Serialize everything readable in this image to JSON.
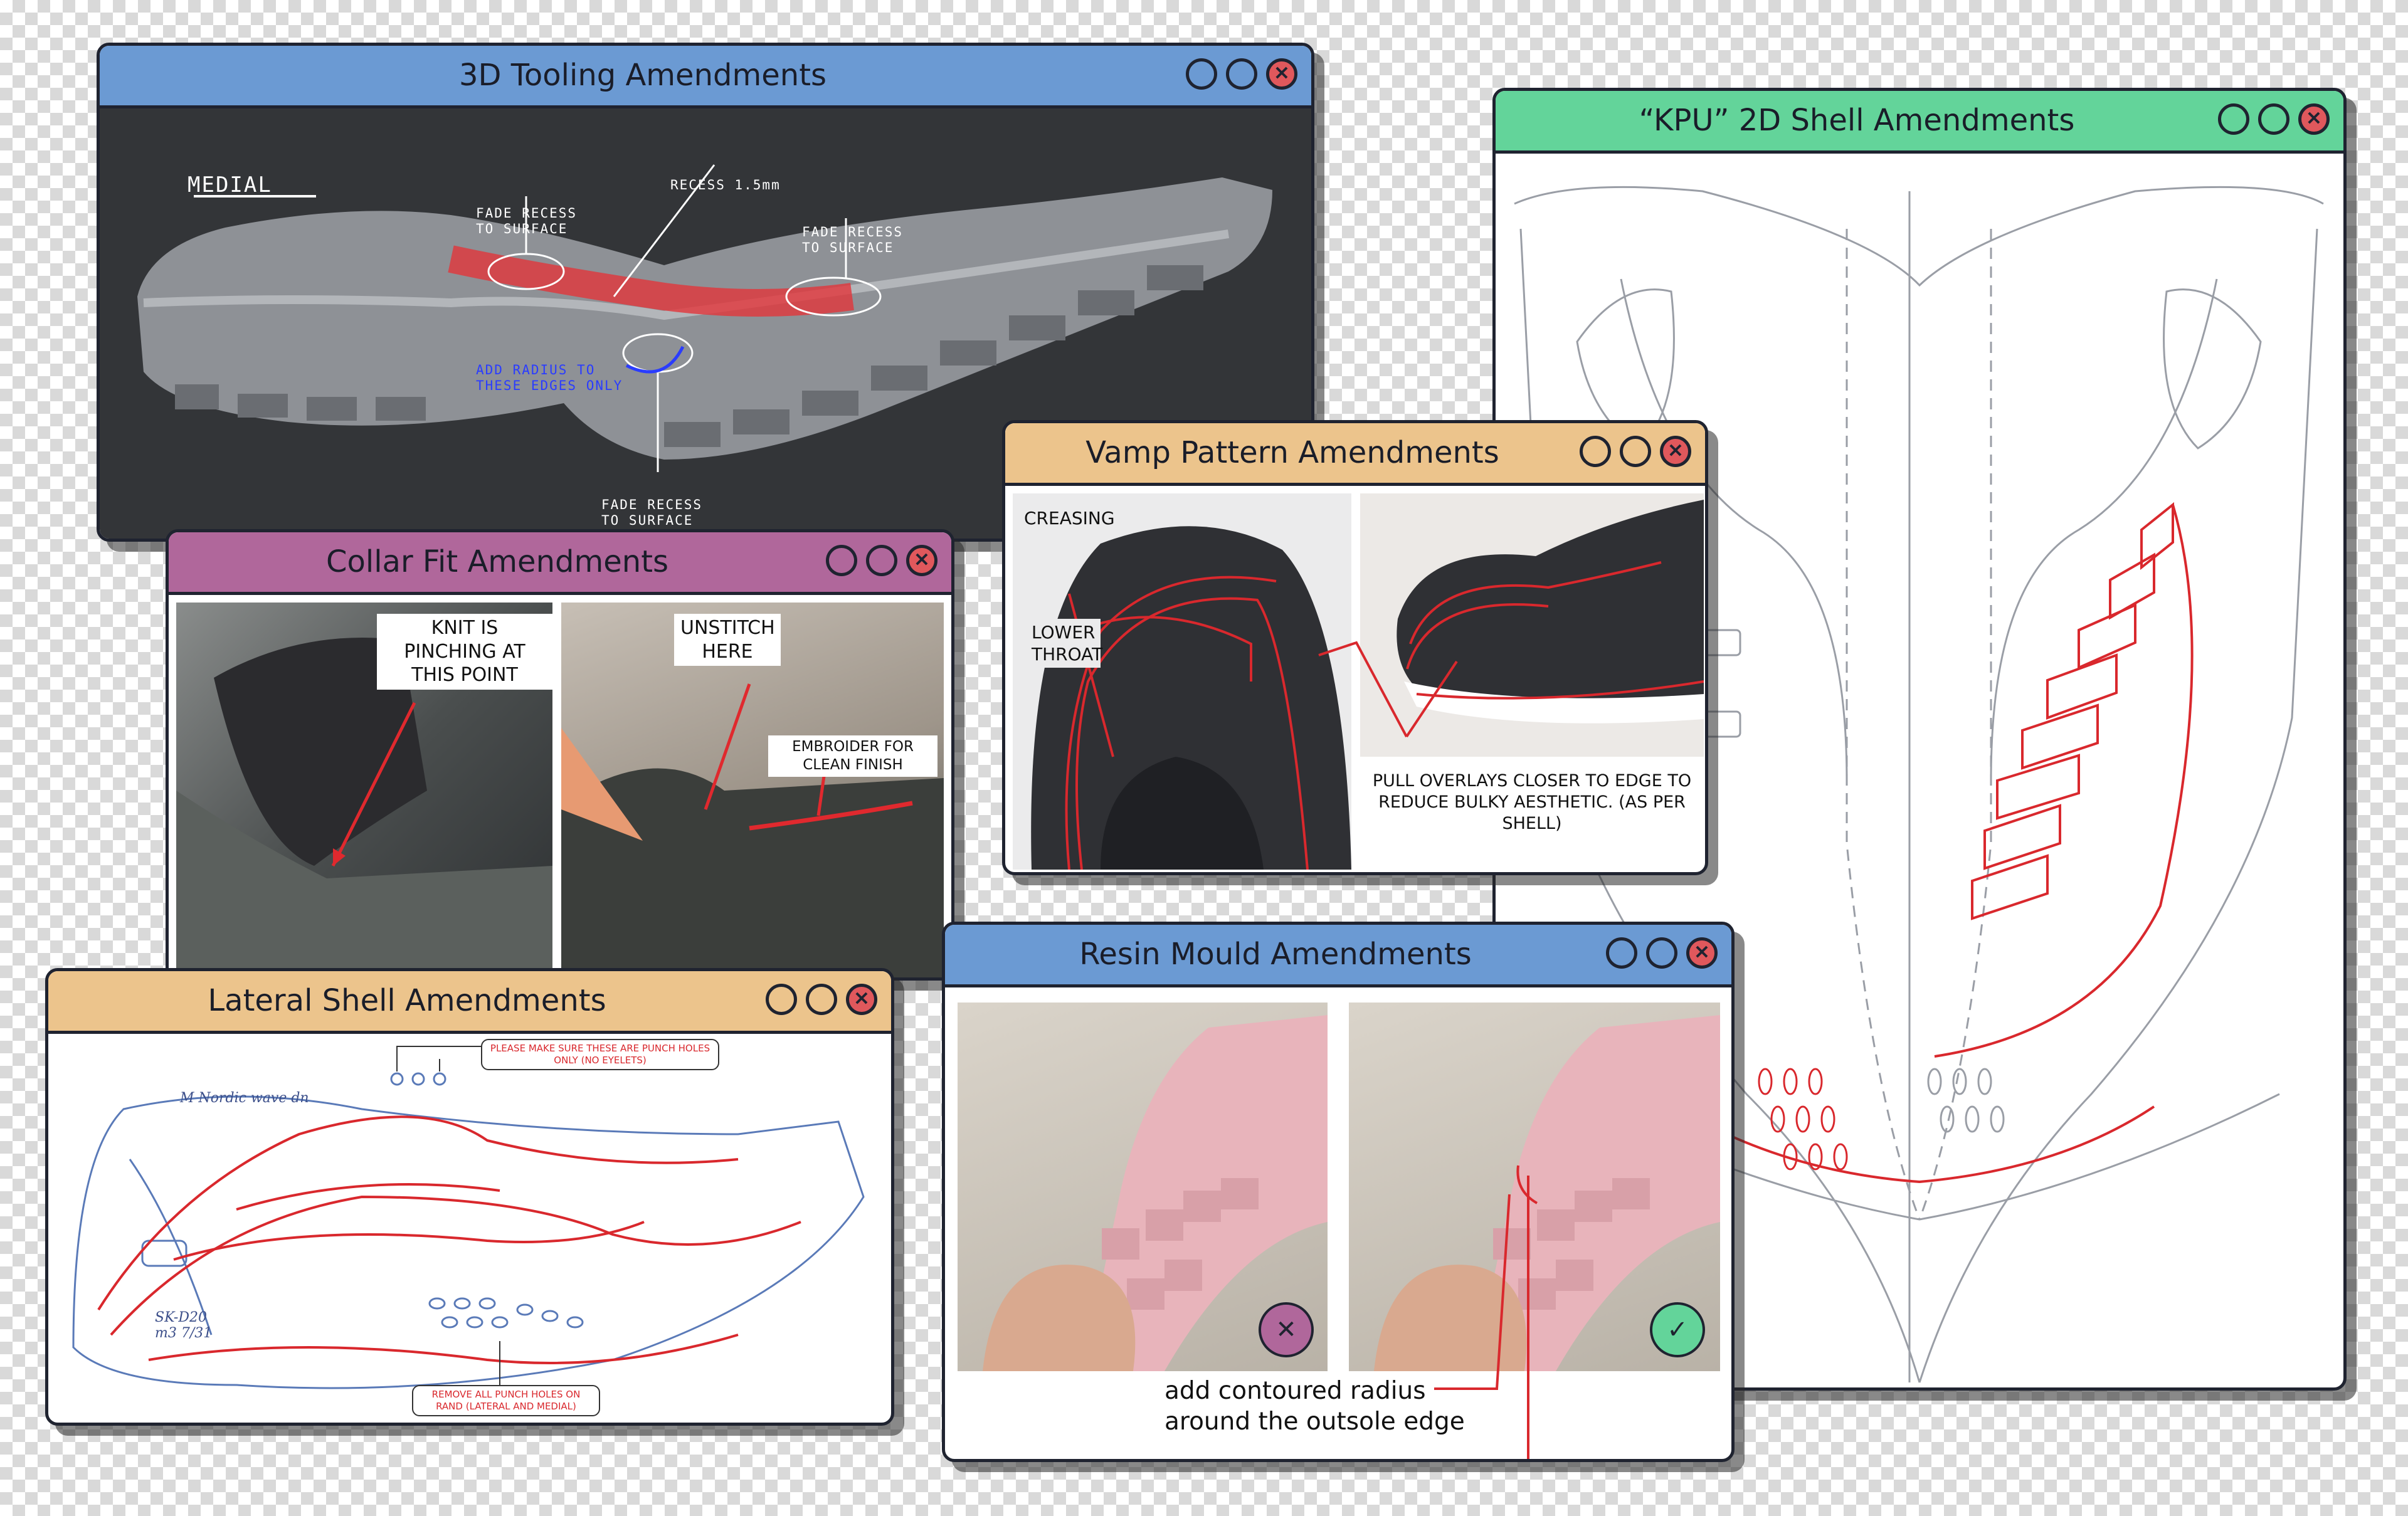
{
  "windows": {
    "tooling": {
      "title": "3D Tooling Amendments",
      "color": "#6b9ad3",
      "notes": {
        "medial": "MEDIAL",
        "recess": "RECESS 1.5mm",
        "fade1": "FADE RECESS TO SURFACE",
        "fade2": "FADE RECESS TO SURFACE",
        "fade3": "FADE RECESS TO SURFACE",
        "radius": "ADD RADIUS TO THESE EDGES ONLY"
      }
    },
    "kpu": {
      "title": "“KPU” 2D Shell Amendments",
      "color": "#63d49a"
    },
    "vamp": {
      "title": "Vamp Pattern Amendments",
      "color": "#ecc48c",
      "labels": {
        "creasing": "CREASING",
        "lower_throat": "LOWER THROAT",
        "overlays": "PULL OVERLAYS CLOSER TO EDGE TO REDUCE BULKY AESTHETIC. (AS PER SHELL)"
      }
    },
    "collar": {
      "title": "Collar Fit Amendments",
      "color": "#b0679b",
      "labels": {
        "pinching": "KNIT IS PINCHING AT THIS POINT",
        "unstitch": "UNSTITCH HERE",
        "embroider": "EMBROIDER FOR CLEAN FINISH"
      }
    },
    "lateral": {
      "title": "Lateral Shell Amendments",
      "color": "#ecc48c",
      "notes": {
        "punch_top": "PLEASE MAKE SURE THESE ARE PUNCH HOLES ONLY (NO EYELETS)",
        "punch_bottom": "REMOVE ALL PUNCH HOLES ON RAND (LATERAL AND MEDIAL)",
        "hand1": "M Nordic wave dn",
        "hand2": "SK-D20 m3 7/31"
      }
    },
    "resin": {
      "title": "Resin Mould Amendments",
      "color": "#6b9ad3",
      "caption": "add contoured radius around the outsole edge",
      "badge_bad": "✕",
      "badge_good": "✓"
    }
  },
  "controls": {
    "min": "",
    "max": "",
    "close": "✕"
  }
}
